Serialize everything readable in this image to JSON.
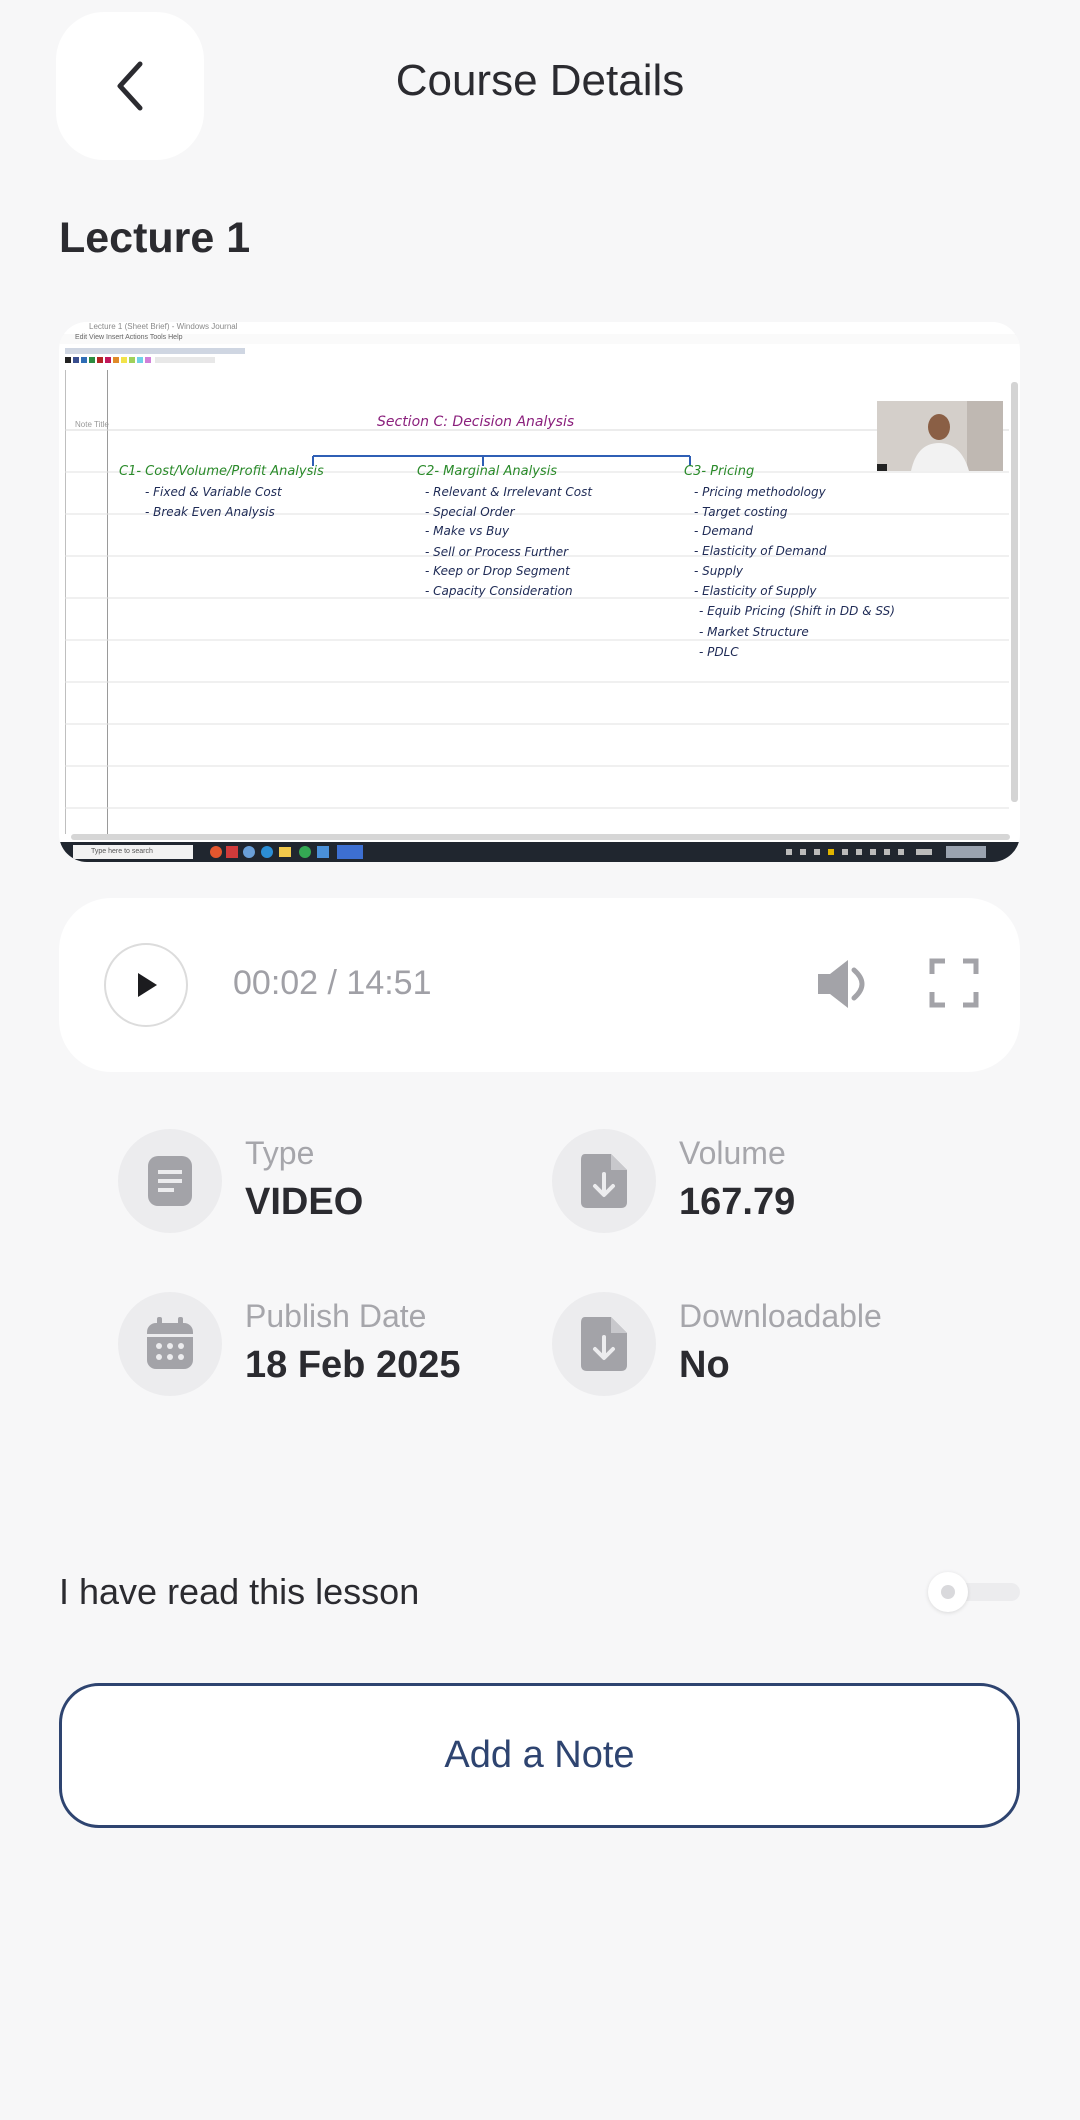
{
  "header": {
    "title": "Course Details",
    "back_icon": "chevron-left-icon"
  },
  "lecture": {
    "title": "Lecture 1"
  },
  "video": {
    "window_title": "Lecture 1 (Sheet Brief) - Windows Journal",
    "menu": "Edit  View  Insert  Actions  Tools  Help",
    "note_title_label": "Note Title",
    "taskbar_search": "Type here to search",
    "whiteboard": {
      "title": "Section C: Decision Analysis",
      "col1_head": "C1- Cost/Volume/Profit Analysis",
      "col1_items": [
        "- Fixed & Variable Cost",
        "- Break Even Analysis"
      ],
      "col2_head": "C2- Marginal Analysis",
      "col2_items": [
        "- Relevant & Irrelevant Cost",
        "- Special Order",
        "- Make vs Buy",
        "- Sell or Process Further",
        "- Keep or Drop Segment",
        "- Capacity Consideration"
      ],
      "col3_head": "C3- Pricing",
      "col3_items": [
        "- Pricing methodology",
        "- Target costing",
        "- Demand",
        "- Elasticity of Demand",
        "- Supply",
        "- Elasticity of Supply",
        "- Equib Pricing (Shift in DD & SS)",
        "- Market Structure",
        "- PDLC"
      ]
    }
  },
  "player": {
    "time": "00:02 / 14:51",
    "play_icon": "play-icon",
    "volume_icon": "volume-icon",
    "fullscreen_icon": "fullscreen-icon"
  },
  "info": {
    "type_label": "Type",
    "type_value": "VIDEO",
    "volume_label": "Volume",
    "volume_value": "167.79",
    "publish_label": "Publish Date",
    "publish_value": "18 Feb 2025",
    "downloadable_label": "Downloadable",
    "downloadable_value": "No"
  },
  "read_toggle": {
    "label": "I have read this lesson",
    "checked": false
  },
  "actions": {
    "add_note": "Add a Note"
  },
  "colors": {
    "accent": "#2e4470",
    "background": "#f7f7f8",
    "icon_grey": "#a3a3a8"
  }
}
